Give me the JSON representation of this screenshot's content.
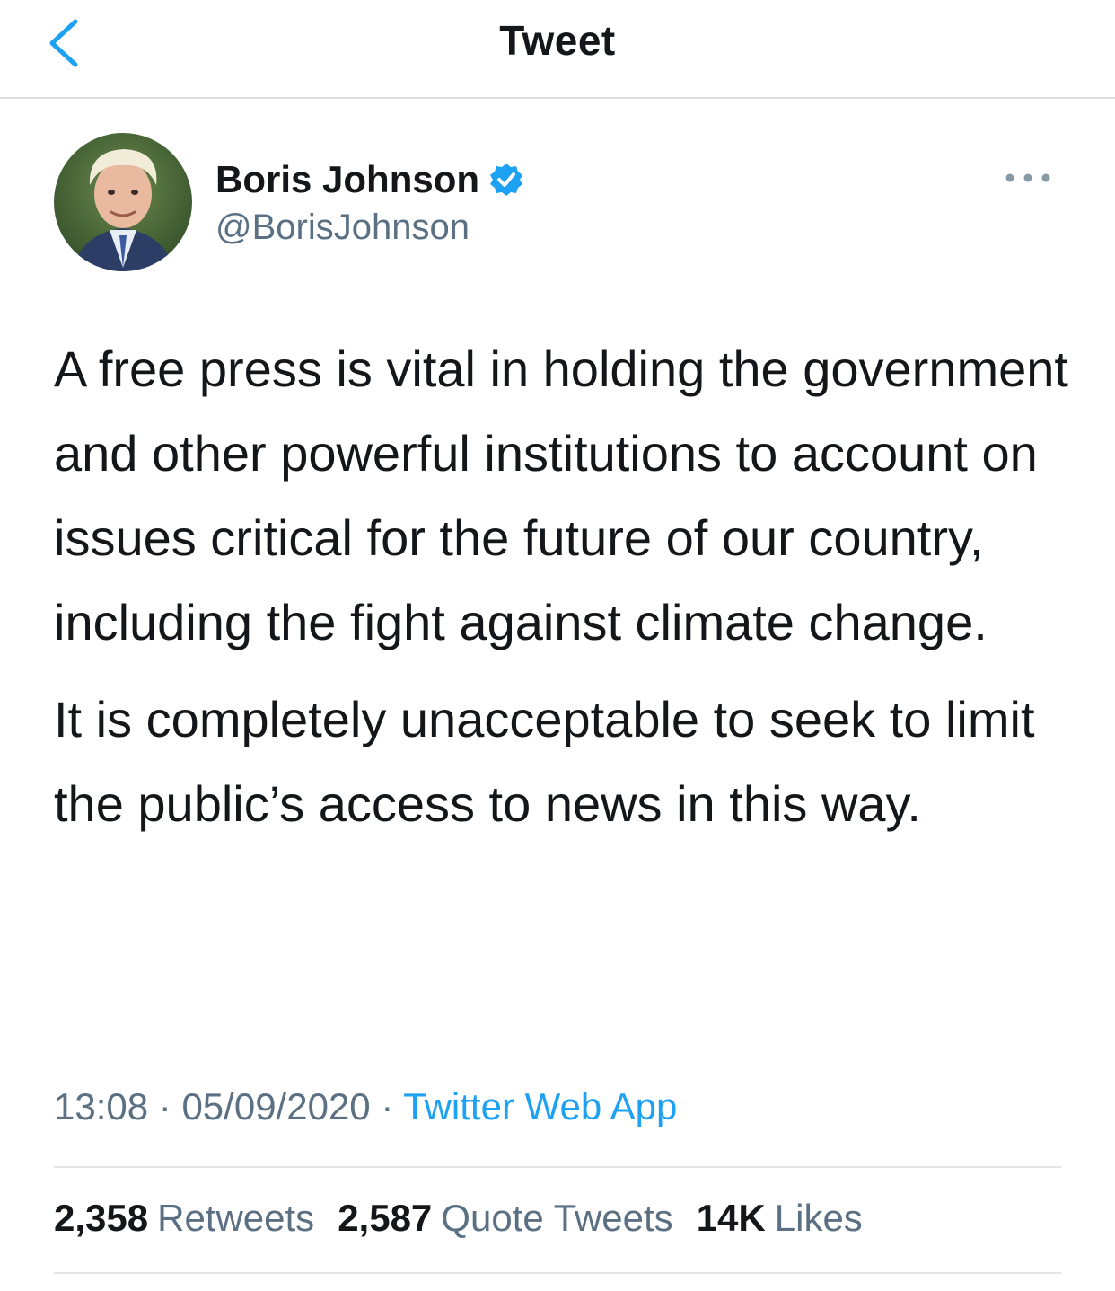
{
  "header": {
    "title": "Tweet",
    "back_icon": "chevron-left-icon"
  },
  "author": {
    "display_name": "Boris Johnson",
    "handle": "@BorisJohnson",
    "verified_icon": "verified-badge-icon",
    "more_icon": "more-horizontal-icon"
  },
  "tweet": {
    "paragraphs": [
      "A free press is vital in holding the government and other powerful institutions to account on issues critical for the future of our country, including the fight against climate change.",
      "It is completely unacceptable to seek to limit the public’s access to news in this way."
    ],
    "time": "13:08",
    "separator": "·",
    "date": "05/09/2020",
    "source": "Twitter Web App"
  },
  "stats": {
    "retweets_count": "2,358",
    "retweets_label": "Retweets",
    "quotes_count": "2,587",
    "quotes_label": "Quote Tweets",
    "likes_count": "14K",
    "likes_label": "Likes"
  },
  "colors": {
    "accent": "#1da1f2",
    "text_primary": "#14171a",
    "text_secondary": "#5b7083",
    "divider": "#e1e6ea"
  }
}
